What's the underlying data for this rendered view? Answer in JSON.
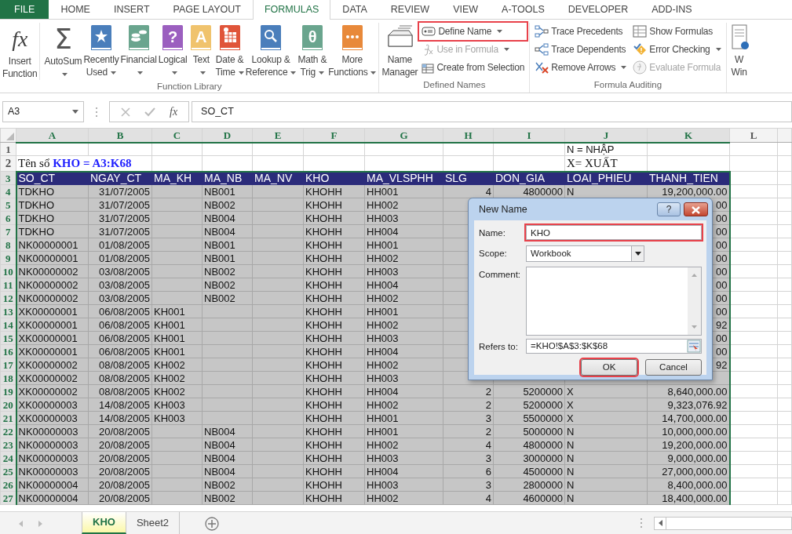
{
  "ribbon_tabs": [
    {
      "label": "FILE",
      "kind": "file",
      "selected": false
    },
    {
      "label": "HOME",
      "kind": "tab",
      "selected": false
    },
    {
      "label": "INSERT",
      "kind": "tab",
      "selected": false
    },
    {
      "label": "PAGE LAYOUT",
      "kind": "tab",
      "selected": false
    },
    {
      "label": "FORMULAS",
      "kind": "tab",
      "selected": true
    },
    {
      "label": "DATA",
      "kind": "tab",
      "selected": false
    },
    {
      "label": "REVIEW",
      "kind": "tab",
      "selected": false
    },
    {
      "label": "VIEW",
      "kind": "tab",
      "selected": false
    },
    {
      "label": "A-TOOLS",
      "kind": "tab",
      "selected": false
    },
    {
      "label": "DEVELOPER",
      "kind": "tab",
      "selected": false
    },
    {
      "label": "ADD-INS",
      "kind": "tab",
      "selected": false
    }
  ],
  "ribbon_groups": [
    {
      "label": "Function Library",
      "buttons": [
        {
          "kind": "big",
          "label": "Insert\nFunction",
          "glyph": "fx",
          "caret": false
        },
        {
          "kind": "big",
          "label": "AutoSum",
          "glyph": "Σ",
          "caret": true
        },
        {
          "kind": "big",
          "label": "Recently\nUsed",
          "caret": true
        },
        {
          "kind": "big",
          "label": "Financial",
          "caret": true
        },
        {
          "kind": "big",
          "label": "Logical",
          "glyph": "?",
          "caret": true
        },
        {
          "kind": "big",
          "label": "Text",
          "glyph": "A",
          "caret": true
        },
        {
          "kind": "big",
          "label": "Date &\nTime",
          "caret": true
        },
        {
          "kind": "big",
          "label": "Lookup &\nReference",
          "caret": true
        },
        {
          "kind": "big",
          "label": "Math &\nTrig",
          "glyph": "θ",
          "caret": true
        },
        {
          "kind": "big",
          "label": "More\nFunctions",
          "caret": true
        }
      ]
    },
    {
      "label": "Defined Names",
      "buttons": [
        {
          "kind": "big",
          "label": "Name\nManager",
          "caret": false
        },
        {
          "kind": "small",
          "label": "Define Name",
          "caret": true,
          "highlighted": true,
          "disabled": false
        },
        {
          "kind": "small",
          "label": "Use in Formula",
          "caret": true,
          "highlighted": false,
          "disabled": true
        },
        {
          "kind": "small",
          "label": "Create from Selection",
          "caret": false,
          "highlighted": false,
          "disabled": false
        }
      ]
    },
    {
      "label": "Formula Auditing",
      "buttons": [
        {
          "kind": "small",
          "label": "Trace Precedents",
          "caret": false,
          "highlighted": false,
          "disabled": false
        },
        {
          "kind": "small",
          "label": "Trace Dependents",
          "caret": false,
          "highlighted": false,
          "disabled": false
        },
        {
          "kind": "small",
          "label": "Remove Arrows",
          "caret": true,
          "highlighted": false,
          "disabled": false
        },
        {
          "kind": "small",
          "label": "Show Formulas",
          "caret": false,
          "highlighted": false,
          "disabled": false
        },
        {
          "kind": "small",
          "label": "Error Checking",
          "caret": true,
          "highlighted": false,
          "disabled": false
        },
        {
          "kind": "small",
          "label": "Evaluate Formula",
          "caret": false,
          "highlighted": false,
          "disabled": true
        }
      ]
    },
    {
      "buttons": [
        {
          "kind": "big",
          "label": "W\nWin",
          "caret": false
        }
      ]
    }
  ],
  "formula_bar": {
    "name_box": "A3",
    "fx": "fx",
    "formula": "SO_CT"
  },
  "sheet": {
    "columns": [
      {
        "letter": "A",
        "selected": true
      },
      {
        "letter": "B",
        "selected": true
      },
      {
        "letter": "C",
        "selected": true
      },
      {
        "letter": "D",
        "selected": true
      },
      {
        "letter": "E",
        "selected": true
      },
      {
        "letter": "F",
        "selected": true
      },
      {
        "letter": "G",
        "selected": true
      },
      {
        "letter": "H",
        "selected": true
      },
      {
        "letter": "I",
        "selected": true
      },
      {
        "letter": "J",
        "selected": true
      },
      {
        "letter": "K",
        "selected": true
      },
      {
        "letter": "L",
        "selected": false
      }
    ],
    "rows": [
      {
        "number": "1",
        "kind": "plain",
        "selected": false,
        "cells": {
          "J": "N = NHẬP"
        }
      },
      {
        "number": "2",
        "kind": "title",
        "selected": false,
        "cells": {
          "A": "Tên sổ **KHO = A3:K68**",
          "J": "X= XUẤT"
        }
      },
      {
        "number": "3",
        "kind": "band",
        "selected": true,
        "cells": {
          "A": "SO_CT",
          "B": "NGAY_CT",
          "C": "MA_KH",
          "D": "MA_NB",
          "E": "MA_NV",
          "F": "KHO",
          "G": "MA_VLSPHH",
          "H": "SLG",
          "I": "DON_GIA",
          "J": "LOAI_PHIEU",
          "K": "THANH_TIEN"
        }
      },
      {
        "number": "4",
        "kind": "data",
        "selected": true,
        "cells": {
          "A": "TDKHO",
          "B": "31/07/2005",
          "D": "NB001",
          "F": "KHOHH",
          "G": "HH001",
          "H": "4",
          "I": "4800000",
          "J": "N",
          "K": "19,200,000.00"
        }
      },
      {
        "number": "5",
        "kind": "data",
        "selected": true,
        "cells": {
          "A": "TDKHO",
          "B": "31/07/2005",
          "D": "NB002",
          "F": "KHOHH",
          "G": "HH002",
          "K": "00"
        }
      },
      {
        "number": "6",
        "kind": "data",
        "selected": true,
        "cells": {
          "A": "TDKHO",
          "B": "31/07/2005",
          "D": "NB004",
          "F": "KHOHH",
          "G": "HH003",
          "K": "00"
        }
      },
      {
        "number": "7",
        "kind": "data",
        "selected": true,
        "cells": {
          "A": "TDKHO",
          "B": "31/07/2005",
          "D": "NB004",
          "F": "KHOHH",
          "G": "HH004",
          "K": "00"
        }
      },
      {
        "number": "8",
        "kind": "data",
        "selected": true,
        "cells": {
          "A": "NK00000001",
          "B": "01/08/2005",
          "D": "NB001",
          "F": "KHOHH",
          "G": "HH001",
          "K": "00"
        }
      },
      {
        "number": "9",
        "kind": "data",
        "selected": true,
        "cells": {
          "A": "NK00000001",
          "B": "01/08/2005",
          "D": "NB001",
          "F": "KHOHH",
          "G": "HH002",
          "K": "00"
        }
      },
      {
        "number": "10",
        "kind": "data",
        "selected": true,
        "cells": {
          "A": "NK00000002",
          "B": "03/08/2005",
          "D": "NB002",
          "F": "KHOHH",
          "G": "HH003",
          "K": "00"
        }
      },
      {
        "number": "11",
        "kind": "data",
        "selected": true,
        "cells": {
          "A": "NK00000002",
          "B": "03/08/2005",
          "D": "NB002",
          "F": "KHOHH",
          "G": "HH004",
          "K": "00"
        }
      },
      {
        "number": "12",
        "kind": "data",
        "selected": true,
        "cells": {
          "A": "NK00000002",
          "B": "03/08/2005",
          "D": "NB002",
          "F": "KHOHH",
          "G": "HH002",
          "K": "00"
        }
      },
      {
        "number": "13",
        "kind": "data",
        "selected": true,
        "cells": {
          "A": "XK00000001",
          "B": "06/08/2005",
          "C": "KH001",
          "F": "KHOHH",
          "G": "HH001",
          "K": "00"
        }
      },
      {
        "number": "14",
        "kind": "data",
        "selected": true,
        "cells": {
          "A": "XK00000001",
          "B": "06/08/2005",
          "C": "KH001",
          "F": "KHOHH",
          "G": "HH002",
          "K": "92"
        }
      },
      {
        "number": "15",
        "kind": "data",
        "selected": true,
        "cells": {
          "A": "XK00000001",
          "B": "06/08/2005",
          "C": "KH001",
          "F": "KHOHH",
          "G": "HH003",
          "K": "00"
        }
      },
      {
        "number": "16",
        "kind": "data",
        "selected": true,
        "cells": {
          "A": "XK00000001",
          "B": "06/08/2005",
          "C": "KH001",
          "F": "KHOHH",
          "G": "HH004",
          "K": "00"
        }
      },
      {
        "number": "17",
        "kind": "data",
        "selected": true,
        "cells": {
          "A": "XK00000002",
          "B": "08/08/2005",
          "C": "KH002",
          "F": "KHOHH",
          "G": "HH002",
          "K": "92"
        }
      },
      {
        "number": "18",
        "kind": "data",
        "selected": true,
        "cells": {
          "A": "XK00000002",
          "B": "08/08/2005",
          "C": "KH002",
          "F": "KHOHH",
          "G": "HH003"
        }
      },
      {
        "number": "19",
        "kind": "data",
        "selected": true,
        "cells": {
          "A": "XK00000002",
          "B": "08/08/2005",
          "C": "KH002",
          "F": "KHOHH",
          "G": "HH004",
          "H": "2",
          "I": "5200000",
          "J": "X",
          "K": "8,640,000.00"
        }
      },
      {
        "number": "20",
        "kind": "data",
        "selected": true,
        "cells": {
          "A": "XK00000003",
          "B": "14/08/2005",
          "C": "KH003",
          "F": "KHOHH",
          "G": "HH002",
          "H": "2",
          "I": "5200000",
          "J": "X",
          "K": "9,323,076.92"
        }
      },
      {
        "number": "21",
        "kind": "data",
        "selected": true,
        "cells": {
          "A": "XK00000003",
          "B": "14/08/2005",
          "C": "KH003",
          "F": "KHOHH",
          "G": "HH001",
          "H": "3",
          "I": "5500000",
          "J": "X",
          "K": "14,700,000.00"
        }
      },
      {
        "number": "22",
        "kind": "data",
        "selected": true,
        "cells": {
          "A": "NK00000003",
          "B": "20/08/2005",
          "D": "NB004",
          "F": "KHOHH",
          "G": "HH001",
          "H": "2",
          "I": "5000000",
          "J": "N",
          "K": "10,000,000.00"
        }
      },
      {
        "number": "23",
        "kind": "data",
        "selected": true,
        "cells": {
          "A": "NK00000003",
          "B": "20/08/2005",
          "D": "NB004",
          "F": "KHOHH",
          "G": "HH002",
          "H": "4",
          "I": "4800000",
          "J": "N",
          "K": "19,200,000.00"
        }
      },
      {
        "number": "24",
        "kind": "data",
        "selected": true,
        "cells": {
          "A": "NK00000003",
          "B": "20/08/2005",
          "D": "NB004",
          "F": "KHOHH",
          "G": "HH003",
          "H": "3",
          "I": "3000000",
          "J": "N",
          "K": "9,000,000.00"
        }
      },
      {
        "number": "25",
        "kind": "data",
        "selected": true,
        "cells": {
          "A": "NK00000003",
          "B": "20/08/2005",
          "D": "NB004",
          "F": "KHOHH",
          "G": "HH004",
          "H": "6",
          "I": "4500000",
          "J": "N",
          "K": "27,000,000.00"
        }
      },
      {
        "number": "26",
        "kind": "data",
        "selected": true,
        "cells": {
          "A": "NK00000004",
          "B": "20/08/2005",
          "D": "NB002",
          "F": "KHOHH",
          "G": "HH003",
          "H": "3",
          "I": "2800000",
          "J": "N",
          "K": "8,400,000.00"
        }
      },
      {
        "number": "27",
        "kind": "data",
        "selected": true,
        "cells": {
          "A": "NK00000004",
          "B": "20/08/2005",
          "D": "NB002",
          "F": "KHOHH",
          "G": "HH002",
          "H": "4",
          "I": "4600000",
          "J": "N",
          "K": "18,400,000.00"
        }
      }
    ]
  },
  "dialog": {
    "title": "New Name",
    "help": "?",
    "fields": [
      {
        "kind": "text",
        "label": "Name:",
        "value": "KHO",
        "highlighted": true
      },
      {
        "kind": "select",
        "label": "Scope:",
        "value": "Workbook",
        "highlighted": false
      },
      {
        "kind": "textarea",
        "label": "Comment:",
        "highlighted": false
      },
      {
        "kind": "ref",
        "label": "Refers to:",
        "value": "=KHO!$A$3:$K$68",
        "highlighted": false
      }
    ],
    "buttons": [
      {
        "label": "OK",
        "highlighted": true
      },
      {
        "label": "Cancel",
        "highlighted": false
      }
    ]
  },
  "sheet_tabs": [
    {
      "label": "KHO",
      "selected": true
    },
    {
      "label": "Sheet2",
      "selected": false
    }
  ]
}
